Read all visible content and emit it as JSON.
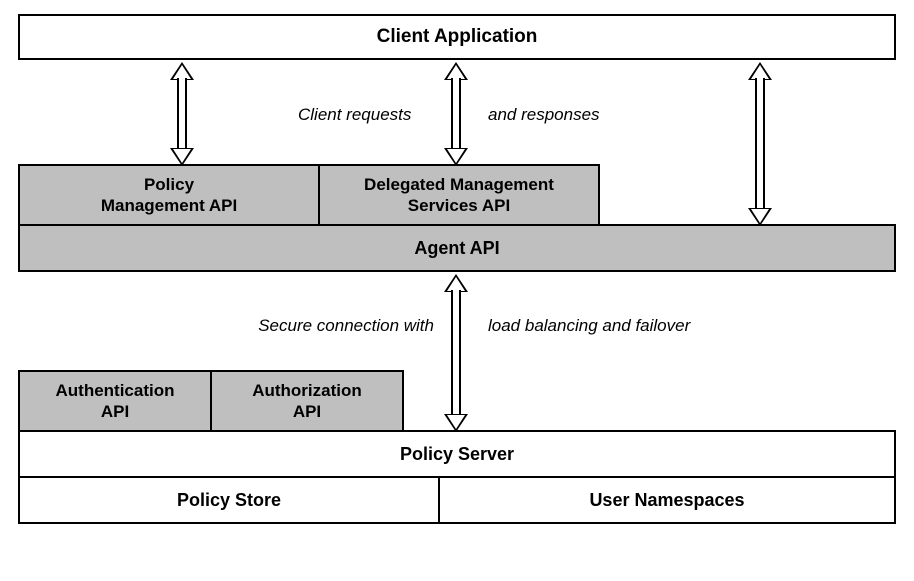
{
  "boxes": {
    "client_application": "Client Application",
    "policy_management_api": "Policy\nManagement API",
    "delegated_management_services_api": "Delegated Management\nServices API",
    "agent_api": "Agent API",
    "authentication_api": "Authentication\nAPI",
    "authorization_api": "Authorization\nAPI",
    "policy_server": "Policy Server",
    "policy_store": "Policy Store",
    "user_namespaces": "User Namespaces"
  },
  "labels": {
    "client_left": "Client requests",
    "client_right": "and responses",
    "secure_left": "Secure connection with",
    "secure_right": "load balancing and failover"
  }
}
